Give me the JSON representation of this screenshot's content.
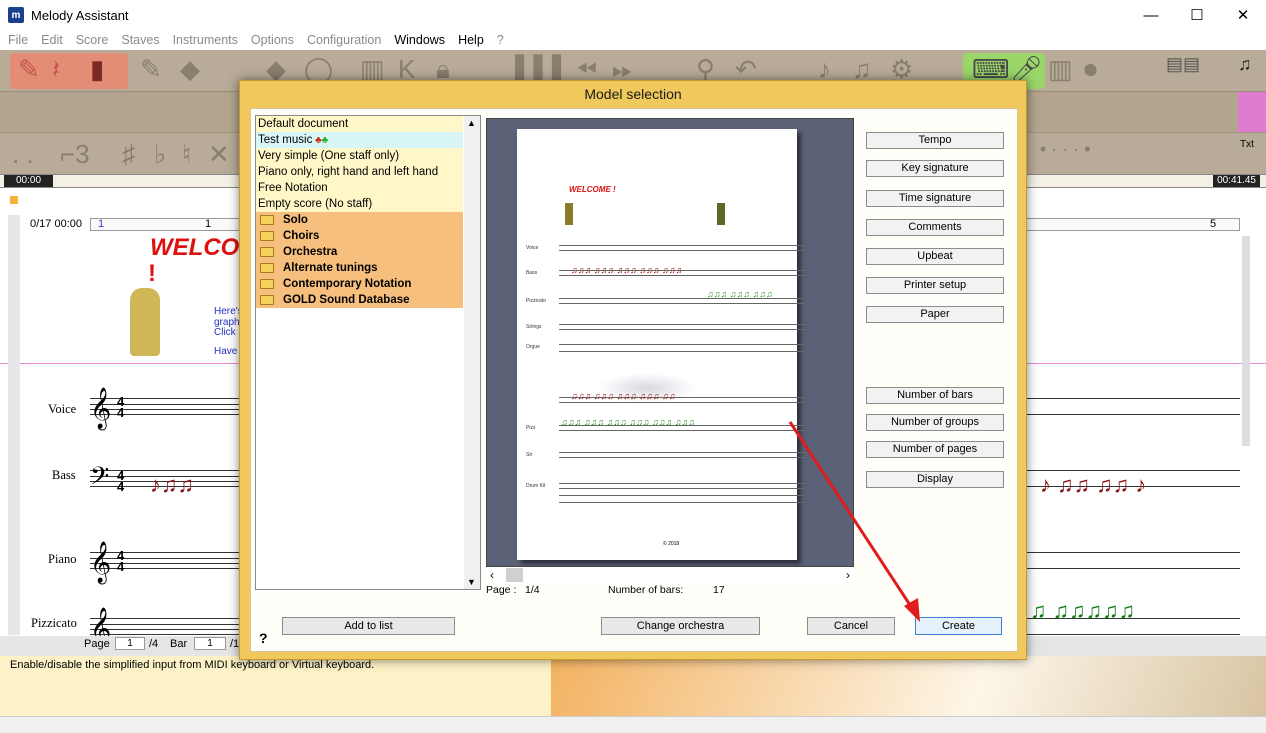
{
  "window": {
    "title": "Melody Assistant",
    "controls": {
      "minimize": "—",
      "maximize": "☐",
      "close": "✕"
    }
  },
  "menu": {
    "items": [
      {
        "label": "File",
        "enabled": false
      },
      {
        "label": "Edit",
        "enabled": false
      },
      {
        "label": "Score",
        "enabled": false
      },
      {
        "label": "Staves",
        "enabled": false
      },
      {
        "label": "Instruments",
        "enabled": false
      },
      {
        "label": "Options",
        "enabled": false
      },
      {
        "label": "Configuration",
        "enabled": false
      },
      {
        "label": "Windows",
        "enabled": true
      },
      {
        "label": "Help",
        "enabled": true
      },
      {
        "label": "?",
        "enabled": false
      }
    ]
  },
  "timebar": {
    "start": "00:00",
    "end": "00:41.45"
  },
  "score": {
    "position": "0/17 00:00",
    "measure_markers": [
      "1",
      "1",
      "5"
    ],
    "welcome": "WELCO",
    "welcome_cont": "!",
    "intro_lines": [
      "Here's",
      "graphi",
      "Click",
      "Have"
    ],
    "instruments": [
      "Voice",
      "Bass",
      "Piano",
      "Pizzicato"
    ],
    "time_sig_top": "4",
    "time_sig_bottom": "4",
    "bottom_bar": {
      "page_label": "Page",
      "page_value": "1",
      "page_total": "/4",
      "bar_label": "Bar",
      "bar_value": "1",
      "bar_total": "/1"
    }
  },
  "status_message": "Enable/disable the simplified input from MIDI keyboard or Virtual keyboard.",
  "dialog": {
    "title": "Model selection",
    "models": [
      {
        "label": "Default document",
        "type": "item"
      },
      {
        "label": "Test music",
        "type": "item",
        "selected": true
      },
      {
        "label": "Very simple (One staff only)",
        "type": "item"
      },
      {
        "label": "Piano only, right hand and left hand",
        "type": "item"
      },
      {
        "label": "Free Notation",
        "type": "item"
      },
      {
        "label": "Empty score (No staff)",
        "type": "item"
      },
      {
        "label": "Solo",
        "type": "folder"
      },
      {
        "label": "Choirs",
        "type": "folder"
      },
      {
        "label": "Orchestra",
        "type": "folder"
      },
      {
        "label": "Alternate tunings",
        "type": "folder"
      },
      {
        "label": "Contemporary Notation",
        "type": "folder"
      },
      {
        "label": "GOLD Sound Database",
        "type": "folder"
      }
    ],
    "preview": {
      "welcome": "WELCOME !",
      "staff_labels": [
        "Voice",
        "Bass",
        "Pizzicato",
        "Strings",
        "Orgue",
        "Pizz",
        "Str",
        "Drum Kit"
      ],
      "footer": "© 2018"
    },
    "page_info": {
      "page_label": "Page :",
      "page_value": "1/4",
      "bars_label": "Number of bars:",
      "bars_value": "17"
    },
    "right_buttons": [
      "Tempo",
      "Key signature",
      "Time signature",
      "Comments",
      "Upbeat",
      "Printer setup",
      "Paper"
    ],
    "right_buttons2": [
      "Number of bars",
      "Number of groups",
      "Number of pages",
      "Display"
    ],
    "help_glyph": "?",
    "buttons": {
      "add": "Add to list",
      "change": "Change orchestra",
      "cancel": "Cancel",
      "create": "Create"
    }
  },
  "colors": {
    "toolbar": "#b8ab97",
    "dialog_frame": "#f0c85b",
    "folder_row": "#f6bf7e",
    "item_row": "#fff7c8",
    "selected_row": "#d8f6f6",
    "arrow": "#e01c1c"
  }
}
